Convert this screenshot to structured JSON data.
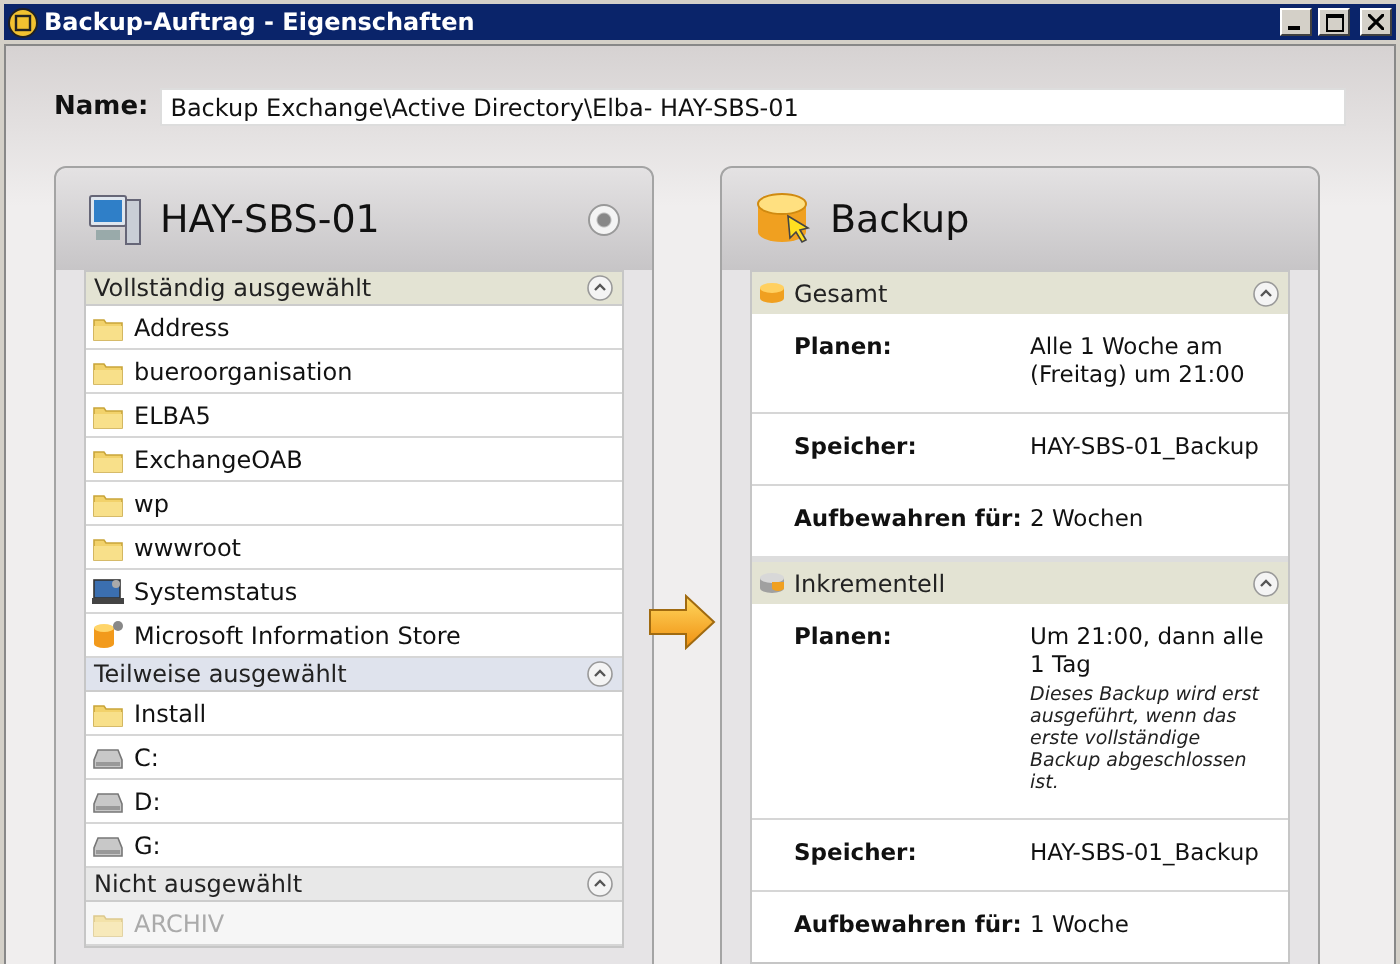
{
  "window": {
    "title": "Backup-Auftrag - Eigenschaften"
  },
  "name_field": {
    "label": "Name:",
    "value": "Backup Exchange\\Active Directory\\Elba- HAY-SBS-01"
  },
  "source": {
    "title": "HAY-SBS-01",
    "sections": [
      {
        "kind": "full",
        "title": "Vollständig ausgewählt",
        "expanded": true,
        "items": [
          {
            "kind": "folder",
            "label": "Address",
            "disabled": false
          },
          {
            "kind": "folder",
            "label": "bueroorganisation",
            "disabled": false
          },
          {
            "kind": "folder",
            "label": "ELBA5",
            "disabled": false
          },
          {
            "kind": "folder",
            "label": "ExchangeOAB",
            "disabled": false
          },
          {
            "kind": "folder",
            "label": "wp",
            "disabled": false
          },
          {
            "kind": "folder",
            "label": "wwwroot",
            "disabled": false
          },
          {
            "kind": "system",
            "label": "Systemstatus",
            "disabled": false
          },
          {
            "kind": "store",
            "label": "Microsoft Information Store",
            "disabled": false
          }
        ]
      },
      {
        "kind": "partial",
        "title": "Teilweise ausgewählt",
        "expanded": true,
        "items": [
          {
            "kind": "folder",
            "label": "Install",
            "disabled": false
          },
          {
            "kind": "drive",
            "label": "C:",
            "disabled": false
          },
          {
            "kind": "drive",
            "label": "D:",
            "disabled": false
          },
          {
            "kind": "drive",
            "label": "G:",
            "disabled": false
          }
        ]
      },
      {
        "kind": "none",
        "title": "Nicht ausgewählt",
        "expanded": true,
        "items": [
          {
            "kind": "folder",
            "label": "ARCHIV",
            "disabled": true
          }
        ]
      }
    ]
  },
  "target": {
    "title": "Backup",
    "sections": [
      {
        "kind": "full",
        "title": "Gesamt",
        "expanded": true,
        "rows": [
          {
            "label": "Planen:",
            "value": "Alle 1 Woche am (Freitag) um 21:00"
          },
          {
            "label": "Speicher:",
            "value": "HAY-SBS-01_Backup"
          },
          {
            "label": "Aufbewahren für:",
            "value": "2 Wochen"
          }
        ]
      },
      {
        "kind": "incremental",
        "title": "Inkrementell",
        "expanded": true,
        "rows": [
          {
            "label": "Planen:",
            "value": "Um 21:00, dann alle 1 Tag",
            "note": "Dieses Backup wird erst ausgeführt, wenn das erste vollständige Backup abgeschlossen ist."
          },
          {
            "label": "Speicher:",
            "value": "HAY-SBS-01_Backup"
          },
          {
            "label": "Aufbewahren für:",
            "value": "1 Woche"
          }
        ]
      }
    ]
  }
}
